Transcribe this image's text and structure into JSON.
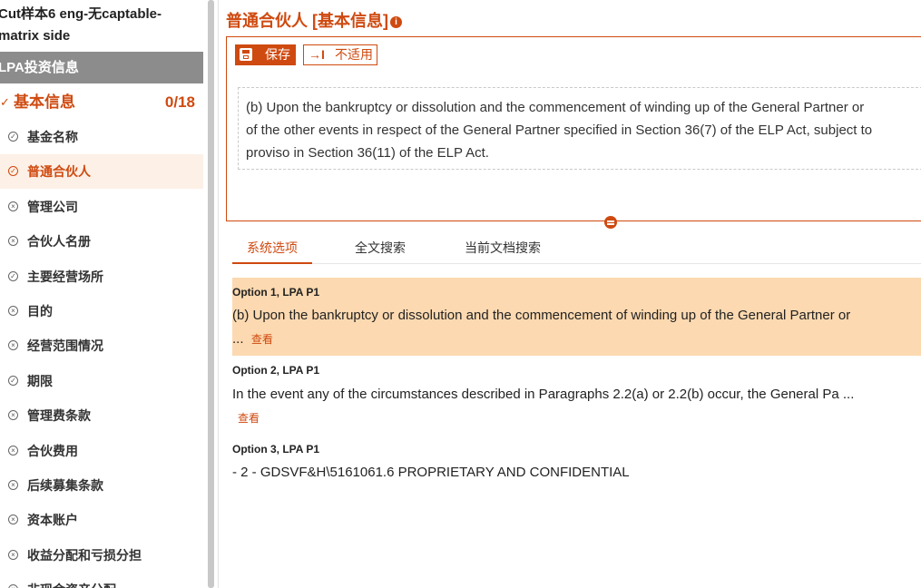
{
  "sidebar": {
    "doc_title_line1": "Cut样本6 eng-无captable-",
    "doc_title_line2": "matrix side",
    "section_header": "LPA投资信息",
    "group": {
      "label": "基本信息",
      "count": "0/18"
    },
    "items": [
      {
        "label": "基金名称",
        "status": "done"
      },
      {
        "label": "普通合伙人",
        "status": "done",
        "active": true
      },
      {
        "label": "管理公司",
        "status": "na"
      },
      {
        "label": "合伙人名册",
        "status": "na"
      },
      {
        "label": "主要经营场所",
        "status": "done"
      },
      {
        "label": "目的",
        "status": "na"
      },
      {
        "label": "经营范围情况",
        "status": "na"
      },
      {
        "label": "期限",
        "status": "done"
      },
      {
        "label": "管理费条款",
        "status": "na"
      },
      {
        "label": "合伙费用",
        "status": "na"
      },
      {
        "label": "后续募集条款",
        "status": "na"
      },
      {
        "label": "资本账户",
        "status": "na"
      },
      {
        "label": "收益分配和亏损分担",
        "status": "na"
      },
      {
        "label": "非现金资产分配",
        "status": "na"
      }
    ]
  },
  "main": {
    "title": "普通合伙人 [基本信息]",
    "info_icon": "i",
    "toolbar": {
      "save_label": "保存",
      "na_label": "不适用",
      "na_icon": "→I"
    },
    "quote_lines": [
      "(b)    Upon the bankruptcy or dissolution and the commencement of winding up of the General Partner or",
      "of the other events in respect of the General Partner specified in Section 36(7) of the ELP Act, subject to",
      "proviso in Section 36(11) of the ELP Act."
    ],
    "tabs": [
      {
        "label": "系统选项"
      },
      {
        "label": "全文搜索"
      },
      {
        "label": "当前文档搜索"
      }
    ],
    "options": [
      {
        "title": "Option 1, LPA P1",
        "line1": "(b) Upon the bankruptcy or dissolution and the commencement of winding up of the General Partner or",
        "line2": "...",
        "view": "查看"
      },
      {
        "title": "Option 2, LPA P1",
        "line1": "In the event any of the circumstances described in Paragraphs 2.2(a) or 2.2(b) occur, the General Pa ...",
        "view": "查看"
      },
      {
        "title": "Option 3, LPA P1",
        "line1": "- 2 - GDSVF&H\\5161061.6 PROPRIETARY AND CONFIDENTIAL"
      }
    ]
  },
  "colors": {
    "accent": "#cf4a10",
    "highlight": "#fcd9b0",
    "active_row": "#fdf0e6",
    "section_header": "#8c8c8c"
  }
}
